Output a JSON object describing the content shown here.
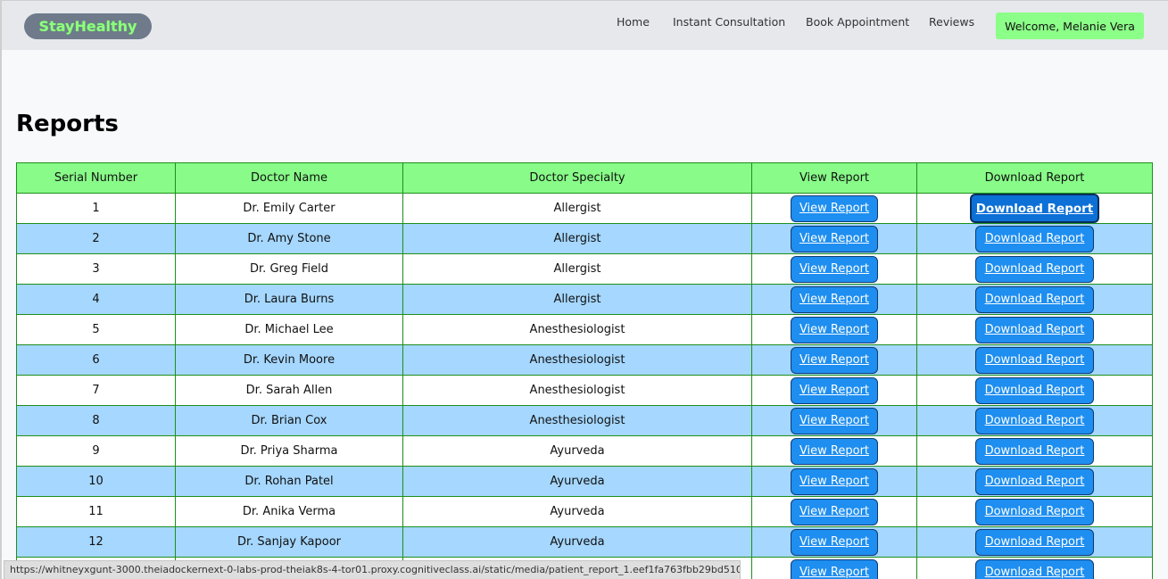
{
  "header": {
    "logo": "StayHealthy",
    "nav": [
      "Home",
      "Instant Consultation",
      "Book Appointment",
      "Reviews"
    ],
    "welcome": "Welcome, Melanie Vera"
  },
  "page": {
    "title": "Reports"
  },
  "table": {
    "headers": [
      "Serial Number",
      "Doctor Name",
      "Doctor Specialty",
      "View Report",
      "Download Report"
    ],
    "view_label": "View Report",
    "download_label": "Download Report",
    "rows": [
      {
        "serial": "1",
        "doctor": "Dr. Emily Carter",
        "specialty": "Allergist"
      },
      {
        "serial": "2",
        "doctor": "Dr. Amy Stone",
        "specialty": "Allergist"
      },
      {
        "serial": "3",
        "doctor": "Dr. Greg Field",
        "specialty": "Allergist"
      },
      {
        "serial": "4",
        "doctor": "Dr. Laura Burns",
        "specialty": "Allergist"
      },
      {
        "serial": "5",
        "doctor": "Dr. Michael Lee",
        "specialty": "Anesthesiologist"
      },
      {
        "serial": "6",
        "doctor": "Dr. Kevin Moore",
        "specialty": "Anesthesiologist"
      },
      {
        "serial": "7",
        "doctor": "Dr. Sarah Allen",
        "specialty": "Anesthesiologist"
      },
      {
        "serial": "8",
        "doctor": "Dr. Brian Cox",
        "specialty": "Anesthesiologist"
      },
      {
        "serial": "9",
        "doctor": "Dr. Priya Sharma",
        "specialty": "Ayurveda"
      },
      {
        "serial": "10",
        "doctor": "Dr. Rohan Patel",
        "specialty": "Ayurveda"
      },
      {
        "serial": "11",
        "doctor": "Dr. Anika Verma",
        "specialty": "Ayurveda"
      },
      {
        "serial": "12",
        "doctor": "Dr. Sanjay Kapoor",
        "specialty": "Ayurveda"
      },
      {
        "serial": "",
        "doctor": "",
        "specialty": ""
      }
    ]
  },
  "status_bar": {
    "url": "https://whitneyxgunt-3000.theiadockernext-0-labs-prod-theiak8s-4-tor01.proxy.cognitiveclass.ai/static/media/patient_report_1.eef1fa763fbb29bd510e.pdf"
  }
}
